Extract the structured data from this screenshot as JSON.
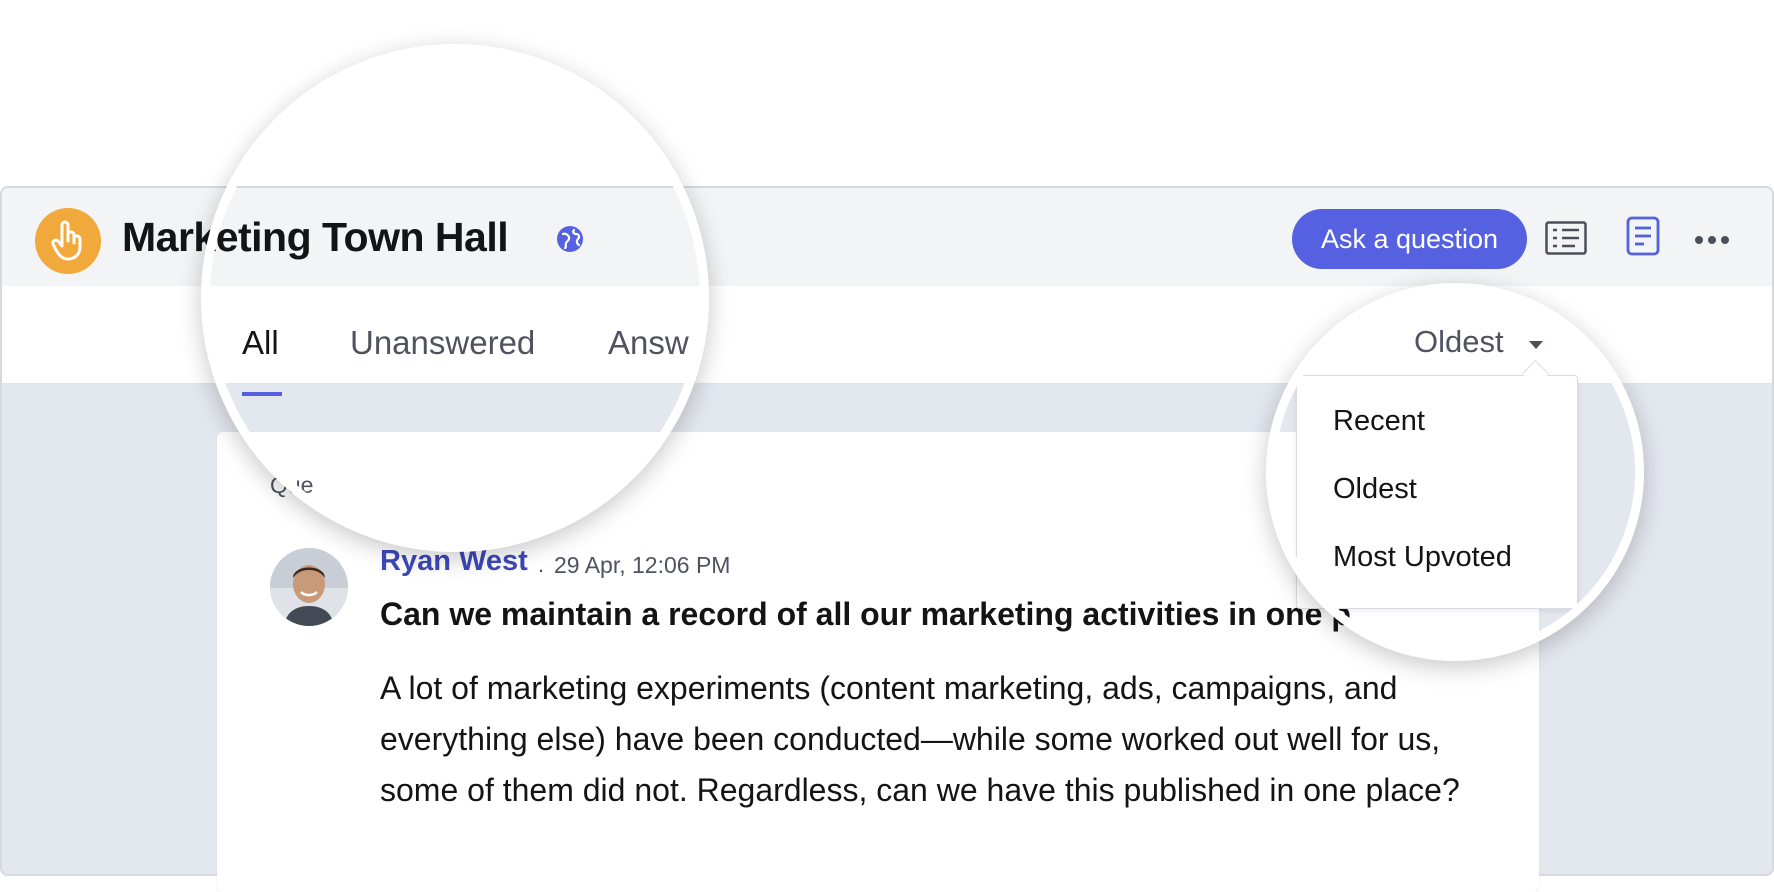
{
  "app": {
    "title": "Marketing Town Hall",
    "ask_label": "Ask a question",
    "accent": "#5561e0",
    "logo_color": "#f2a93b"
  },
  "icons": {
    "logo": "raised-hand-icon",
    "visibility": "globe-icon",
    "list_view": "list-view-icon",
    "document": "document-icon",
    "more": "more-horizontal-icon",
    "sort_caret": "caret-down-icon"
  },
  "tabs": [
    {
      "label": "All",
      "active": true
    },
    {
      "label": "Unanswered",
      "active": false
    },
    {
      "label": "Answ",
      "active": false
    }
  ],
  "sort": {
    "selected": "Oldest",
    "options": [
      "Recent",
      "Oldest",
      "Most Upvoted"
    ]
  },
  "question": {
    "label": "Que",
    "author": "Ryan West",
    "separator": ".",
    "time": "29 Apr, 12:06 PM",
    "title": "Can we maintain a record of all our marketing activities in one p",
    "body": "A lot of marketing experiments (content marketing, ads, campaigns, and everything else) have been conducted—while some worked out well for us, some of them did not. Regardless, can we have this published in one place?"
  }
}
